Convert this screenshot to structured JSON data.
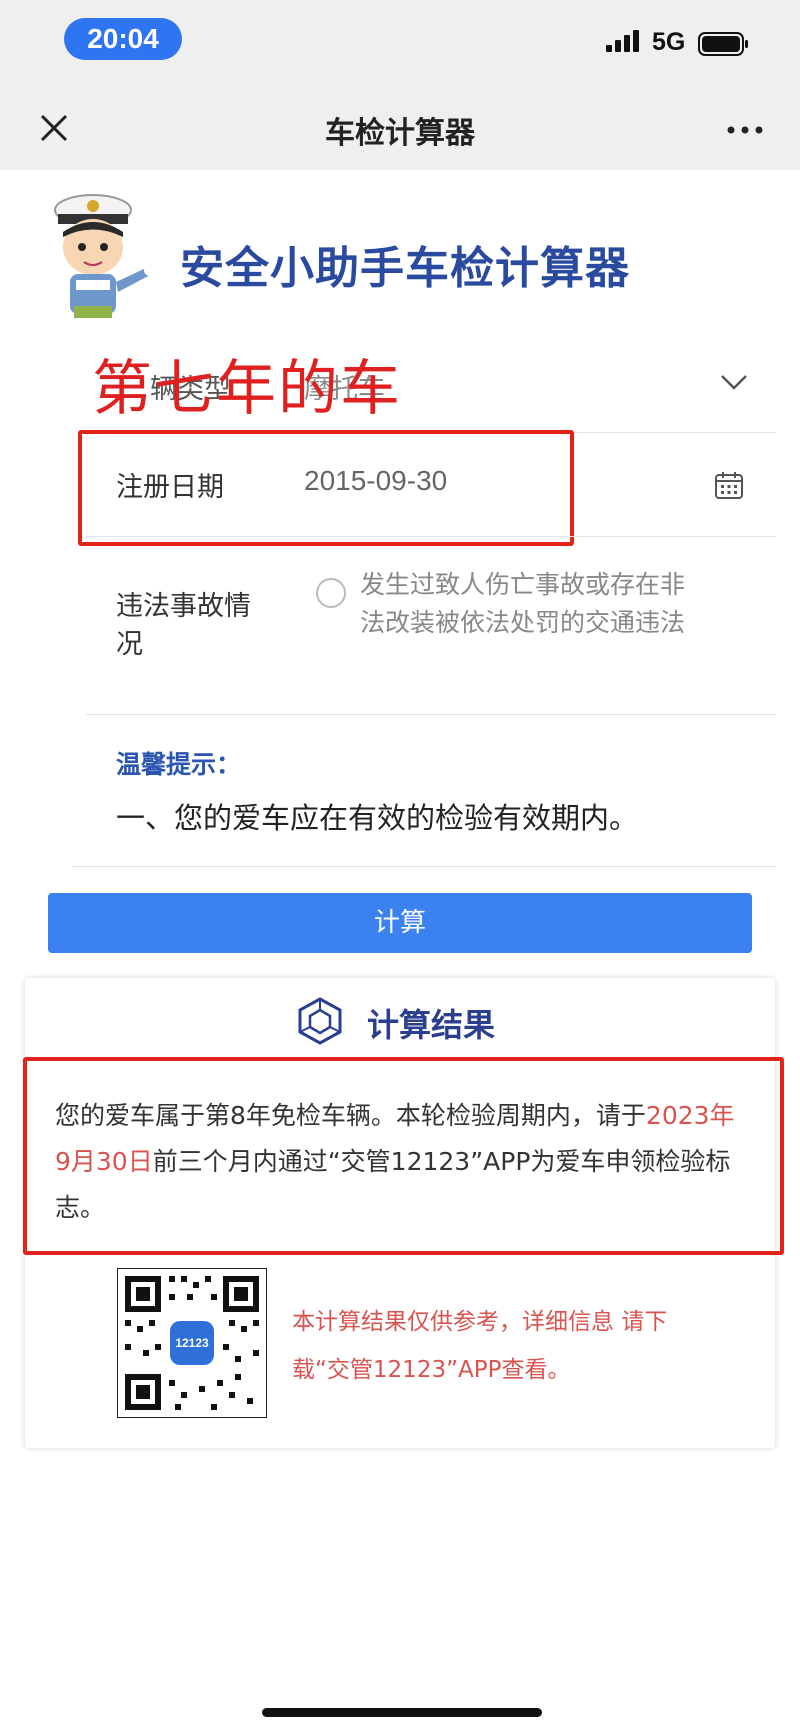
{
  "status_bar": {
    "time": "20:04",
    "network": "5G",
    "icons": [
      "signal-icon",
      "battery-icon"
    ]
  },
  "nav": {
    "title": "车检计算器",
    "close_icon": "close-icon",
    "more_icon": "more-icon"
  },
  "header": {
    "title": "安全小助手车检计算器",
    "mascot": "police-mascot-icon"
  },
  "overlay_annotation": "第七年的车",
  "form": {
    "vehicle_type": {
      "label": "辆类型",
      "value": "摩托车"
    },
    "registration_date": {
      "label": "注册日期",
      "value": "2015-09-30"
    },
    "violation": {
      "label": "违法事故情况",
      "option_text": "发生过致人伤亡事故或存在非法改装被依法处罚的交通违法"
    }
  },
  "tips": {
    "title": "温馨提示：",
    "text": "一、您的爱车应在有效的检验有效期内。"
  },
  "calc_button": "计算",
  "result": {
    "title": "计算结果",
    "text_part1": "您的爱车属于第8年免检车辆。本轮检验周期内，请于",
    "text_highlight": "2023年9月30日",
    "text_part2": "前三个月内通过“交管12123”APP为爱车申领检验标志。",
    "qr_label": "12123",
    "disclaimer": "本计算结果仅供参考，详细信息 请下载“交管12123”APP查看。"
  },
  "colors": {
    "accent": "#3b82f0",
    "title_blue": "#2a4aa0",
    "annotation_red": "#e2231a",
    "highlight_red": "#d9534f"
  }
}
